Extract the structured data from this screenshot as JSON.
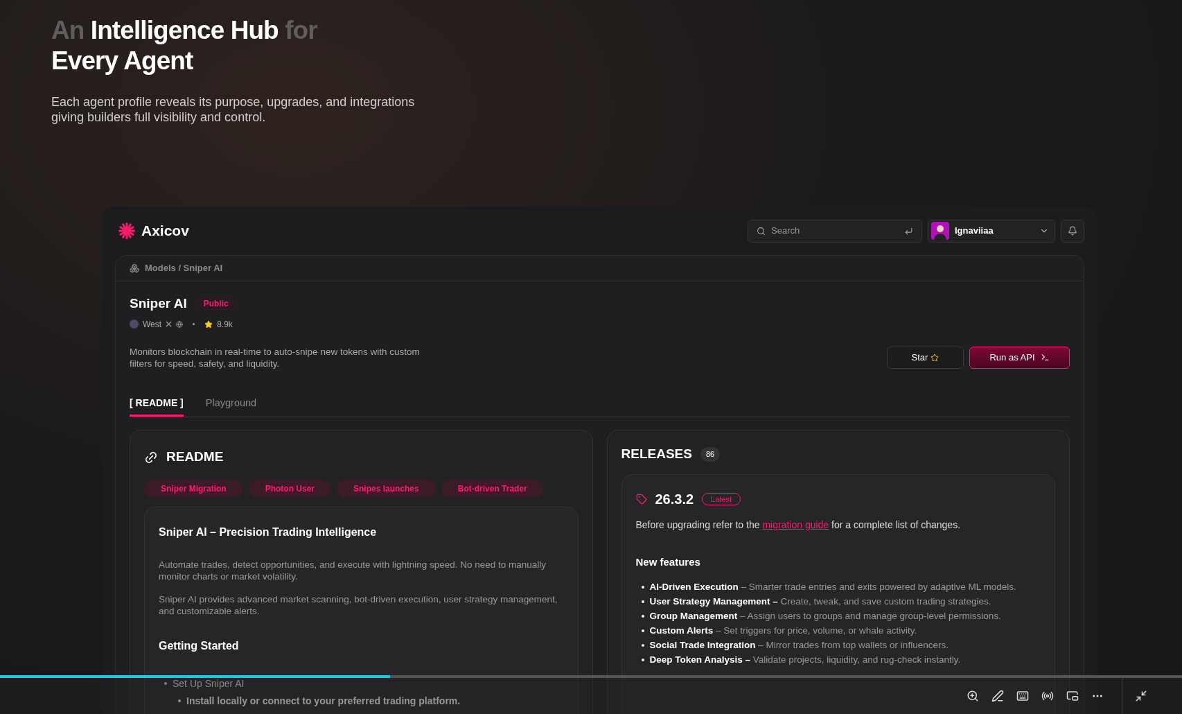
{
  "hero": {
    "title_lines": [
      [
        {
          "text": "An",
          "highlighted": false
        },
        {
          "text": "Intelligence Hub",
          "highlighted": true
        },
        {
          "text": "for",
          "highlighted": false
        }
      ],
      [
        {
          "text": "Every Agent",
          "highlighted": true
        }
      ]
    ],
    "subtitle": "Each agent profile reveals its purpose, upgrades, and integrations giving builders full visibility and control."
  },
  "app": {
    "brand": "Axicov",
    "search": {
      "placeholder": "Search"
    },
    "user": {
      "name": "Ignaviiaa"
    },
    "breadcrumb": "Models / Sniper AI",
    "model": {
      "name": "Sniper AI",
      "visibility": "Public",
      "author": "West",
      "stars": "8.9k",
      "description": "Monitors blockchain in real-time to auto-snipe new tokens with custom filters for speed, safety, and liquidity."
    },
    "actions": [
      {
        "label": "Star",
        "kind": "secondary"
      },
      {
        "label": "Run as API",
        "kind": "primary"
      }
    ],
    "tabs": [
      {
        "label": "[ README ]",
        "selected": true
      },
      {
        "label": "Playground",
        "selected": false
      }
    ],
    "readme": {
      "title": "README",
      "tags": [
        "Sniper Migration",
        "Photon User",
        "Snipes launches",
        "Bot-driven Trader"
      ],
      "heading": "Sniper AI – Precision Trading Intelligence",
      "paragraphs": [
        "Automate trades, detect opportunities, and execute with lightning speed. No need to manually monitor charts or market volatility.",
        "Sniper AI provides advanced market scanning, bot-driven execution, user strategy management, and customizable alerts."
      ],
      "subheading": "Getting Started",
      "steps": [
        {
          "text": "Set Up Sniper AI",
          "children": [
            {
              "text": "Install locally or connect to your preferred trading platform."
            }
          ]
        }
      ]
    },
    "releases": {
      "title": "RELEASES",
      "count": "86",
      "version": "26.3.2",
      "badge": "Latest",
      "note_before": "Before upgrading refer to the",
      "link": "migration guide",
      "note_after": "for a complete list of changes.",
      "features_title": "New features",
      "features": [
        {
          "name": "AI-Driven Execution",
          "text": "– Smarter trade entries and exits powered by adaptive ML models."
        },
        {
          "name": "User Strategy Management –",
          "text": "Create, tweak, and save custom trading strategies."
        },
        {
          "name": "Group Management",
          "text": "– Assign users to groups and manage group-level permissions."
        },
        {
          "name": "Custom Alerts",
          "text": "– Set triggers for price, volume, or whale activity."
        },
        {
          "name": "Social Trade Integration",
          "text": "– Mirror trades from top wallets or influencers."
        },
        {
          "name": "Deep Token Analysis –",
          "text": "Validate projects, liquidity, and rug-check instantly."
        }
      ]
    }
  },
  "player": {
    "level": 0.33
  }
}
